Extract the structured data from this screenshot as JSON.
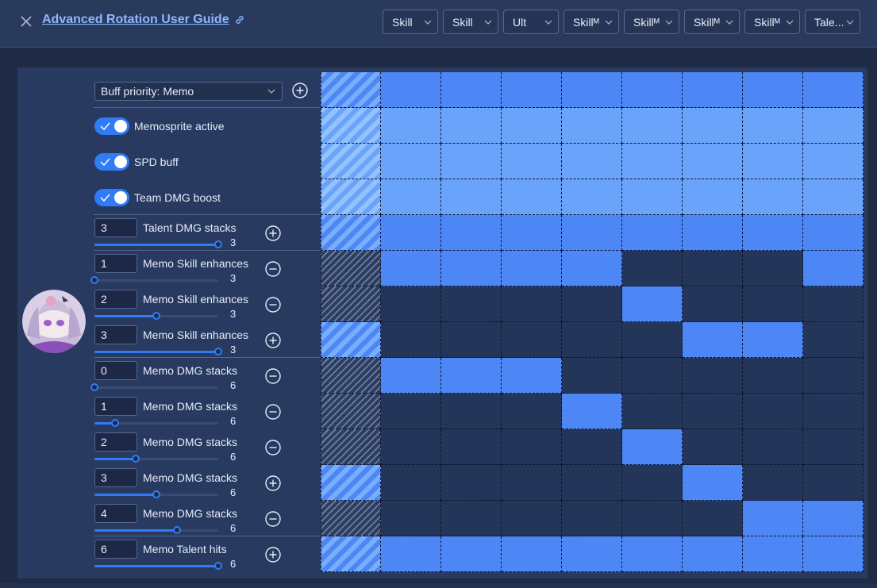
{
  "header": {
    "close_icon": "close-icon",
    "title": "Advanced Rotation User Guide",
    "link_icon": "external-link-icon",
    "tabs": [
      "Skill",
      "Skill",
      "Ult",
      "Skillᴹ",
      "Skillᴹ",
      "Skillᴹ",
      "Skillᴹ",
      "Tale..."
    ]
  },
  "avatar_icon": "character-portrait",
  "controls": {
    "buff_priority": "Buff priority: Memo",
    "toggles": [
      {
        "label": "Memosprite active",
        "on": true
      },
      {
        "label": "SPD buff",
        "on": true
      },
      {
        "label": "Team DMG boost",
        "on": true
      }
    ],
    "conditionals": [
      {
        "value": "3",
        "label": "Talent DMG stacks",
        "max": "3",
        "button": "plus",
        "level": 1.0
      },
      {
        "value": "1",
        "label": "Memo Skill enhances",
        "max": "3",
        "button": "minus",
        "level": 0.0
      },
      {
        "value": "2",
        "label": "Memo Skill enhances",
        "max": "3",
        "button": "minus",
        "level": 0.5
      },
      {
        "value": "3",
        "label": "Memo Skill enhances",
        "max": "3",
        "button": "plus",
        "level": 1.0
      },
      {
        "value": "0",
        "label": "Memo DMG stacks",
        "max": "6",
        "button": "minus",
        "level": 0.0
      },
      {
        "value": "1",
        "label": "Memo DMG stacks",
        "max": "6",
        "button": "minus",
        "level": 0.1667
      },
      {
        "value": "2",
        "label": "Memo DMG stacks",
        "max": "6",
        "button": "minus",
        "level": 0.3333
      },
      {
        "value": "3",
        "label": "Memo DMG stacks",
        "max": "6",
        "button": "plus",
        "level": 0.5
      },
      {
        "value": "4",
        "label": "Memo DMG stacks",
        "max": "6",
        "button": "minus",
        "level": 0.6667
      },
      {
        "value": "6",
        "label": "Memo Talent hits",
        "max": "6",
        "button": "plus",
        "level": 1.0
      }
    ]
  },
  "grid": {
    "colors": {
      "on": "#4d86f5",
      "light": "#6aa4fa",
      "off": "#23365a"
    },
    "rows": [
      {
        "default": "on",
        "cells": [
          "on",
          "on",
          "on",
          "on",
          "on",
          "on",
          "on",
          "on"
        ]
      },
      {
        "default": "light",
        "cells": [
          "light",
          "light",
          "light",
          "light",
          "light",
          "light",
          "light",
          "light"
        ]
      },
      {
        "default": "light",
        "cells": [
          "light",
          "light",
          "light",
          "light",
          "light",
          "light",
          "light",
          "light"
        ]
      },
      {
        "default": "light",
        "cells": [
          "light",
          "light",
          "light",
          "light",
          "light",
          "light",
          "light",
          "light"
        ]
      },
      {
        "default": "on",
        "cells": [
          "on",
          "on",
          "on",
          "on",
          "on",
          "on",
          "on",
          "on"
        ]
      },
      {
        "default": "off",
        "cells": [
          "on",
          "on",
          "on",
          "on",
          "off",
          "off",
          "off",
          "on"
        ]
      },
      {
        "default": "off",
        "cells": [
          "off",
          "off",
          "off",
          "off",
          "on",
          "off",
          "off",
          "off"
        ]
      },
      {
        "default": "on",
        "cells": [
          "off",
          "off",
          "off",
          "off",
          "off",
          "on",
          "on",
          "off"
        ]
      },
      {
        "default": "off",
        "cells": [
          "on",
          "on",
          "on",
          "off",
          "off",
          "off",
          "off",
          "off"
        ]
      },
      {
        "default": "off",
        "cells": [
          "off",
          "off",
          "off",
          "on",
          "off",
          "off",
          "off",
          "off"
        ]
      },
      {
        "default": "off",
        "cells": [
          "off",
          "off",
          "off",
          "off",
          "on",
          "off",
          "off",
          "off"
        ]
      },
      {
        "default": "on",
        "cells": [
          "off",
          "off",
          "off",
          "off",
          "off",
          "on",
          "off",
          "off"
        ]
      },
      {
        "default": "off",
        "cells": [
          "off",
          "off",
          "off",
          "off",
          "off",
          "off",
          "on",
          "on"
        ]
      },
      {
        "default": "on",
        "cells": [
          "on",
          "on",
          "on",
          "on",
          "on",
          "on",
          "on",
          "on"
        ]
      }
    ]
  }
}
